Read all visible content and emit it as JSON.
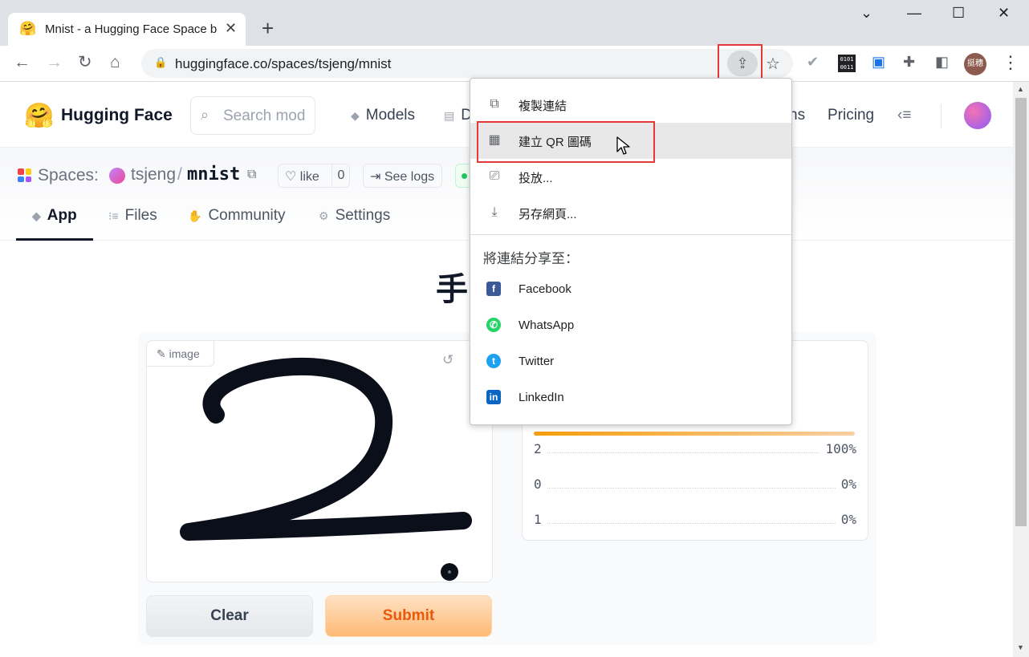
{
  "browser": {
    "tab_title": "Mnist - a Hugging Face Space b",
    "tab_favicon": "🤗",
    "new_tab": "+",
    "url": "huggingface.co/spaces/tsjeng/mnist",
    "profile_label": "挺穗",
    "binary_icon_text": "0101 0011"
  },
  "hf": {
    "brand": "Hugging Face",
    "logo": "🤗",
    "search_placeholder": "Search mod",
    "nav": {
      "models": "Models",
      "datasets": "D",
      "docs_partial": "ns",
      "pricing": "Pricing",
      "more": "≡"
    }
  },
  "space": {
    "label": "Spaces:",
    "owner": "tsjeng",
    "slash": "/",
    "name": "mnist",
    "like_label": "like",
    "like_count": "0",
    "logs_label": "See logs",
    "tabs": {
      "app": "App",
      "files": "Files",
      "community": "Community",
      "settings": "Settings"
    }
  },
  "app": {
    "title": "手",
    "image_label": "image",
    "clear_label": "Clear",
    "submit_label": "Submit",
    "predictions": [
      {
        "label": "2",
        "value": "100%",
        "fraction": 1.0
      },
      {
        "label": "0",
        "value": "0%",
        "fraction": 0.0
      },
      {
        "label": "1",
        "value": "0%",
        "fraction": 0.0
      }
    ]
  },
  "share_menu": {
    "copy_link": "複製連結",
    "create_qr": "建立 QR 圖碼",
    "cast": "投放...",
    "save_page": "另存網頁...",
    "share_to": "將連結分享至：",
    "facebook": "Facebook",
    "whatsapp": "WhatsApp",
    "twitter": "Twitter",
    "linkedin": "LinkedIn"
  },
  "colors": {
    "highlight_box": "#e53935",
    "facebook": "#3b5998",
    "whatsapp": "#25d366",
    "twitter": "#1da1f2",
    "linkedin": "#0a66c2",
    "submit_text": "#ea580c"
  }
}
